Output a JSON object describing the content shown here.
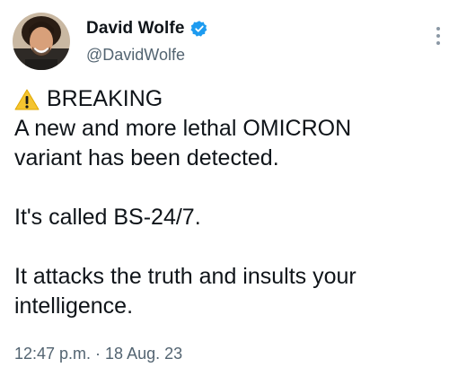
{
  "author": {
    "display_name": "David Wolfe",
    "handle": "@DavidWolfe",
    "verified": true
  },
  "tweet": {
    "breaking_label": "BREAKING",
    "line_1": "A new and more lethal OMICRON",
    "line_2": "variant has been detected.",
    "line_3": "It's called BS-24/7.",
    "line_4": "It attacks the truth and insults your",
    "line_5": "intelligence.",
    "timestamp": "12:47 p.m. · 18 Aug. 23"
  },
  "icons": {
    "warning": "warning-icon",
    "verified": "verified-badge-icon",
    "more": "more-options-icon"
  },
  "colors": {
    "text": "#0f1419",
    "secondary": "#536471",
    "verified_blue": "#1d9bf0",
    "warning_yellow": "#f4c430"
  }
}
